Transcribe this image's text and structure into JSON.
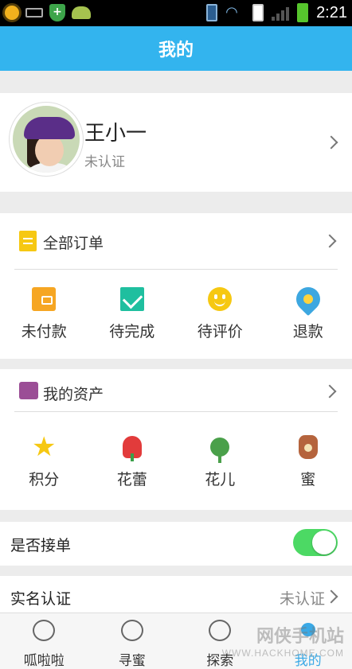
{
  "status_bar": {
    "time": "2:21",
    "icons": [
      "weather-sun-icon",
      "usb-icon",
      "security-shield-icon",
      "android-icon",
      "sim-card-icon",
      "wifi-icon",
      "signal-bars-icon",
      "battery-charging-icon"
    ]
  },
  "header": {
    "title": "我的"
  },
  "profile": {
    "name": "王小一",
    "verification": "未认证"
  },
  "orders": {
    "title": "全部订单",
    "items": [
      {
        "label": "未付款",
        "icon": "wallet-icon",
        "color": "#f6a623"
      },
      {
        "label": "待完成",
        "icon": "checkmark-icon",
        "color": "#1fbf9f"
      },
      {
        "label": "待评价",
        "icon": "smiley-icon",
        "color": "#f6c812"
      },
      {
        "label": "退款",
        "icon": "refund-icon",
        "color": "#3da7e0"
      }
    ]
  },
  "assets": {
    "title": "我的资产",
    "items": [
      {
        "label": "积分",
        "icon": "star-icon",
        "color": "#f6c812"
      },
      {
        "label": "花蕾",
        "icon": "rose-icon",
        "color": "#e23b3b"
      },
      {
        "label": "花儿",
        "icon": "flower-icon",
        "color": "#4aa04a"
      },
      {
        "label": "蜜",
        "icon": "honey-jar-icon",
        "color": "#b5643d"
      }
    ]
  },
  "accept_orders": {
    "label": "是否接单",
    "enabled": true
  },
  "real_name": {
    "label": "实名认证",
    "value": "未认证"
  },
  "tabs": [
    {
      "label": "呱啦啦",
      "icon": "moon-icon",
      "active": false
    },
    {
      "label": "寻蜜",
      "icon": "chat-bubble-icon",
      "active": false
    },
    {
      "label": "探索",
      "icon": "explore-icon",
      "active": false
    },
    {
      "label": "我的",
      "icon": "person-icon",
      "active": true
    }
  ],
  "watermark": {
    "text": "网侠手机站",
    "sub": "WWW.HACKHOME.COM"
  },
  "colors": {
    "header": "#33b4ee",
    "toggle_on": "#4cd964",
    "active_tab": "#3aa9e6"
  }
}
